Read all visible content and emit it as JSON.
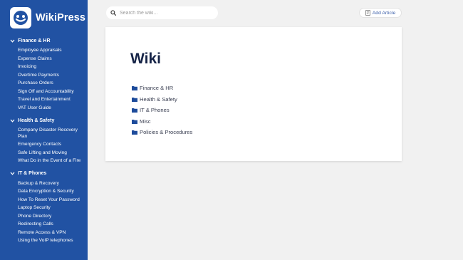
{
  "brand": {
    "name": "WikiPress"
  },
  "search": {
    "placeholder": "Search the wiki..."
  },
  "toolbar": {
    "add_article_label": "Add Article"
  },
  "page": {
    "title": "Wiki"
  },
  "colors": {
    "sidebar": "#2152a3",
    "background": "#f1f1f1",
    "folder": "#1d4b9b",
    "title": "#162447"
  },
  "sidebar": {
    "sections": [
      {
        "title": "Finance & HR",
        "items": [
          "Employee Appraisals",
          "Expense Claims",
          "Invoicing",
          "Overtime Payments",
          "Purchase Orders",
          "Sign Off and Accountability",
          "Travel and Entertainment",
          "VAT User Guide"
        ]
      },
      {
        "title": "Health & Safety",
        "items": [
          "Company Disaster Recovery Plan",
          "Emergency Contacts",
          "Safe Lifting and Moving",
          "What Do in the Event of a Fire"
        ]
      },
      {
        "title": "IT & Phones",
        "items": [
          "Backup & Recovery",
          "Data Encryption & Security",
          "How To Reset Your Password",
          "Laptop Security",
          "Phone Directory",
          "Redirecting Calls",
          "Remote Access & VPN",
          "Using the VoIP telephones"
        ]
      }
    ]
  },
  "folders": [
    "Finance & HR",
    "Health & Safety",
    "IT & Phones",
    "Misc",
    "Policies & Procedures"
  ],
  "icons": {
    "logo": "wikipress-logo-icon",
    "search": "search-icon",
    "add": "add-article-icon",
    "folder": "folder-icon",
    "chevron": "chevron-down-icon"
  }
}
